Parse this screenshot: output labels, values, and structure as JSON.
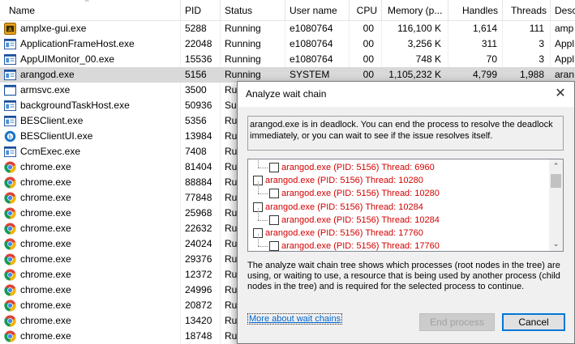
{
  "columns": [
    {
      "key": "name",
      "label": "Name"
    },
    {
      "key": "pid",
      "label": "PID"
    },
    {
      "key": "status",
      "label": "Status"
    },
    {
      "key": "user",
      "label": "User name"
    },
    {
      "key": "cpu",
      "label": "CPU"
    },
    {
      "key": "memory",
      "label": "Memory (p..."
    },
    {
      "key": "handles",
      "label": "Handles"
    },
    {
      "key": "threads",
      "label": "Threads"
    },
    {
      "key": "desc",
      "label": "Desc"
    }
  ],
  "rows": [
    {
      "icon": "amplxe-app-icon",
      "name": "amplxe-gui.exe",
      "pid": "5288",
      "status": "Running",
      "user": "e1080764",
      "cpu": "00",
      "memory": "116,100 K",
      "handles": "1,614",
      "threads": "111",
      "desc": "amp"
    },
    {
      "icon": "window-app-icon",
      "name": "ApplicationFrameHost.exe",
      "pid": "22048",
      "status": "Running",
      "user": "e1080764",
      "cpu": "00",
      "memory": "3,256 K",
      "handles": "311",
      "threads": "3",
      "desc": "Appl"
    },
    {
      "icon": "window-app-icon",
      "name": "AppUIMonitor_00.exe",
      "pid": "15536",
      "status": "Running",
      "user": "e1080764",
      "cpu": "00",
      "memory": "748 K",
      "handles": "70",
      "threads": "3",
      "desc": "Appl"
    },
    {
      "icon": "window-app-icon",
      "name": "arangod.exe",
      "pid": "5156",
      "status": "Running",
      "user": "SYSTEM",
      "cpu": "00",
      "memory": "1,105,232 K",
      "handles": "4,799",
      "threads": "1,988",
      "desc": "aran",
      "selected": true
    },
    {
      "icon": "blank-window-icon",
      "name": "armsvc.exe",
      "pid": "3500",
      "status": "Run",
      "user": "",
      "cpu": "",
      "memory": "",
      "handles": "",
      "threads": "",
      "desc": ""
    },
    {
      "icon": "window-app-icon",
      "name": "backgroundTaskHost.exe",
      "pid": "50936",
      "status": "Sus",
      "user": "",
      "cpu": "",
      "memory": "",
      "handles": "",
      "threads": "",
      "desc": ""
    },
    {
      "icon": "window-app-icon",
      "name": "BESClient.exe",
      "pid": "5356",
      "status": "Run",
      "user": "",
      "cpu": "",
      "memory": "",
      "handles": "",
      "threads": "",
      "desc": ""
    },
    {
      "icon": "bes-client-ui-icon",
      "name": "BESClientUI.exe",
      "pid": "13984",
      "status": "Run",
      "user": "",
      "cpu": "",
      "memory": "",
      "handles": "",
      "threads": "",
      "desc": ""
    },
    {
      "icon": "window-app-icon",
      "name": "CcmExec.exe",
      "pid": "7408",
      "status": "Run",
      "user": "",
      "cpu": "",
      "memory": "",
      "handles": "",
      "threads": "",
      "desc": ""
    },
    {
      "icon": "chrome-icon",
      "name": "chrome.exe",
      "pid": "81404",
      "status": "Run",
      "user": "",
      "cpu": "",
      "memory": "",
      "handles": "",
      "threads": "",
      "desc": ""
    },
    {
      "icon": "chrome-icon",
      "name": "chrome.exe",
      "pid": "88884",
      "status": "Run",
      "user": "",
      "cpu": "",
      "memory": "",
      "handles": "",
      "threads": "",
      "desc": ""
    },
    {
      "icon": "chrome-icon",
      "name": "chrome.exe",
      "pid": "77848",
      "status": "Run",
      "user": "",
      "cpu": "",
      "memory": "",
      "handles": "",
      "threads": "",
      "desc": ""
    },
    {
      "icon": "chrome-icon",
      "name": "chrome.exe",
      "pid": "25968",
      "status": "Run",
      "user": "",
      "cpu": "",
      "memory": "",
      "handles": "",
      "threads": "",
      "desc": ""
    },
    {
      "icon": "chrome-icon",
      "name": "chrome.exe",
      "pid": "22632",
      "status": "Run",
      "user": "",
      "cpu": "",
      "memory": "",
      "handles": "",
      "threads": "",
      "desc": ""
    },
    {
      "icon": "chrome-icon",
      "name": "chrome.exe",
      "pid": "24024",
      "status": "Run",
      "user": "",
      "cpu": "",
      "memory": "",
      "handles": "",
      "threads": "",
      "desc": ""
    },
    {
      "icon": "chrome-icon",
      "name": "chrome.exe",
      "pid": "29376",
      "status": "Run",
      "user": "",
      "cpu": "",
      "memory": "",
      "handles": "",
      "threads": "",
      "desc": ""
    },
    {
      "icon": "chrome-icon",
      "name": "chrome.exe",
      "pid": "12372",
      "status": "Run",
      "user": "",
      "cpu": "",
      "memory": "",
      "handles": "",
      "threads": "",
      "desc": ""
    },
    {
      "icon": "chrome-icon",
      "name": "chrome.exe",
      "pid": "24996",
      "status": "Run",
      "user": "",
      "cpu": "",
      "memory": "",
      "handles": "",
      "threads": "",
      "desc": ""
    },
    {
      "icon": "chrome-icon",
      "name": "chrome.exe",
      "pid": "20872",
      "status": "Run",
      "user": "",
      "cpu": "",
      "memory": "",
      "handles": "",
      "threads": "",
      "desc": ""
    },
    {
      "icon": "chrome-icon",
      "name": "chrome.exe",
      "pid": "13420",
      "status": "Run",
      "user": "",
      "cpu": "",
      "memory": "",
      "handles": "",
      "threads": "",
      "desc": ""
    },
    {
      "icon": "chrome-icon",
      "name": "chrome.exe",
      "pid": "18748",
      "status": "Run",
      "user": "",
      "cpu": "",
      "memory": "",
      "handles": "",
      "threads": "",
      "desc": ""
    }
  ],
  "dialog": {
    "title": "Analyze wait chain",
    "close_icon": "close-icon",
    "message": "arangod.exe is in deadlock. You can end the process to resolve the deadlock immediately, or you can wait to see if the issue resolves itself.",
    "tree_items": [
      {
        "text": "arangod.exe (PID: 5156) Thread: 6960",
        "level": 1
      },
      {
        "text": "arangod.exe (PID: 5156) Thread: 10280",
        "level": 0
      },
      {
        "text": "arangod.exe (PID: 5156) Thread: 10280",
        "level": 1
      },
      {
        "text": "arangod.exe (PID: 5156) Thread: 10284",
        "level": 0
      },
      {
        "text": "arangod.exe (PID: 5156) Thread: 10284",
        "level": 1
      },
      {
        "text": "arangod.exe (PID: 5156) Thread: 17760",
        "level": 0
      },
      {
        "text": "arangod.exe (PID: 5156) Thread: 17760",
        "level": 1
      }
    ],
    "description": "The analyze wait chain tree shows which processes (root nodes in the tree) are using, or waiting to use, a resource that is being used by another process (child nodes in the tree) and is required for the selected process to continue.",
    "link_label": "More about wait chains",
    "end_process_label": "End process",
    "cancel_label": "Cancel"
  },
  "colors": {
    "selected_row": "#d9d9d9",
    "tree_text": "#d40000",
    "link": "#0066cc",
    "primary_border": "#0078d7"
  }
}
